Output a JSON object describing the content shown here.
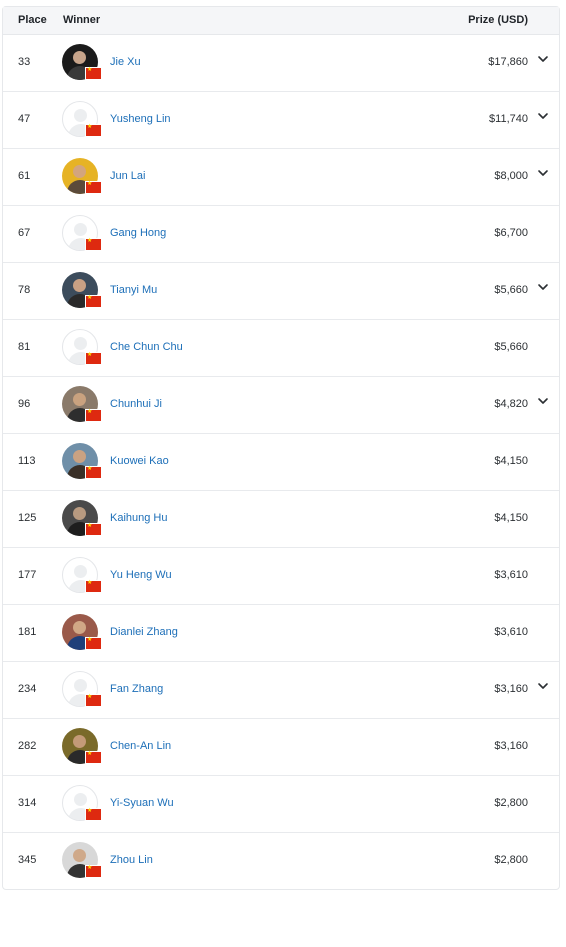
{
  "table": {
    "headers": {
      "place": "Place",
      "winner": "Winner",
      "prize": "Prize (USD)"
    },
    "rows": [
      {
        "place": "33",
        "name": "Jie Xu",
        "prize": "$17,860",
        "avatar": "photo",
        "avatar_colors": [
          "#1b1b1b",
          "#3a3a3a",
          "#c8a58b"
        ],
        "expandable": true
      },
      {
        "place": "47",
        "name": "Yusheng Lin",
        "prize": "$11,740",
        "avatar": "default",
        "expandable": true
      },
      {
        "place": "61",
        "name": "Jun Lai",
        "prize": "$8,000",
        "avatar": "photo",
        "avatar_colors": [
          "#e6b325",
          "#5b4a3a",
          "#d3a57e"
        ],
        "expandable": true
      },
      {
        "place": "67",
        "name": "Gang Hong",
        "prize": "$6,700",
        "avatar": "default",
        "expandable": false
      },
      {
        "place": "78",
        "name": "Tianyi Mu",
        "prize": "$5,660",
        "avatar": "photo",
        "avatar_colors": [
          "#3c4c5c",
          "#2a2a2a",
          "#c9a184"
        ],
        "expandable": true
      },
      {
        "place": "81",
        "name": "Che Chun Chu",
        "prize": "$5,660",
        "avatar": "default",
        "expandable": false
      },
      {
        "place": "96",
        "name": "Chunhui Ji",
        "prize": "$4,820",
        "avatar": "photo",
        "avatar_colors": [
          "#8a7a6a",
          "#2e2e2e",
          "#c9a27f"
        ],
        "expandable": true
      },
      {
        "place": "113",
        "name": "Kuowei Kao",
        "prize": "$4,150",
        "avatar": "photo",
        "avatar_colors": [
          "#6f8fa8",
          "#3a3028",
          "#caa282"
        ],
        "expandable": false
      },
      {
        "place": "125",
        "name": "Kaihung Hu",
        "prize": "$4,150",
        "avatar": "photo",
        "avatar_colors": [
          "#4a4a4a",
          "#1e1e1e",
          "#b89a80"
        ],
        "expandable": false
      },
      {
        "place": "177",
        "name": "Yu Heng Wu",
        "prize": "$3,610",
        "avatar": "default",
        "expandable": false
      },
      {
        "place": "181",
        "name": "Dianlei Zhang",
        "prize": "$3,610",
        "avatar": "photo",
        "avatar_colors": [
          "#9a5a4a",
          "#1f3f7a",
          "#d1a886"
        ],
        "expandable": false
      },
      {
        "place": "234",
        "name": "Fan Zhang",
        "prize": "$3,160",
        "avatar": "default",
        "expandable": true
      },
      {
        "place": "282",
        "name": "Chen-An Lin",
        "prize": "$3,160",
        "avatar": "photo",
        "avatar_colors": [
          "#7a6a2a",
          "#2a2a2a",
          "#c49a78"
        ],
        "expandable": false
      },
      {
        "place": "314",
        "name": "Yi-Syuan Wu",
        "prize": "$2,800",
        "avatar": "default",
        "expandable": false
      },
      {
        "place": "345",
        "name": "Zhou Lin",
        "prize": "$2,800",
        "avatar": "photo",
        "avatar_colors": [
          "#d8d8d8",
          "#333333",
          "#cfa98a"
        ],
        "expandable": false
      }
    ]
  },
  "icons": {
    "flag": "china-flag-icon",
    "expand": "chevron-down-icon",
    "avatar_default": "default-avatar-icon"
  },
  "colors": {
    "link": "#1d6fb8",
    "flag_red": "#de2910",
    "flag_star": "#ffde00",
    "header_bg": "#f5f6f8"
  }
}
